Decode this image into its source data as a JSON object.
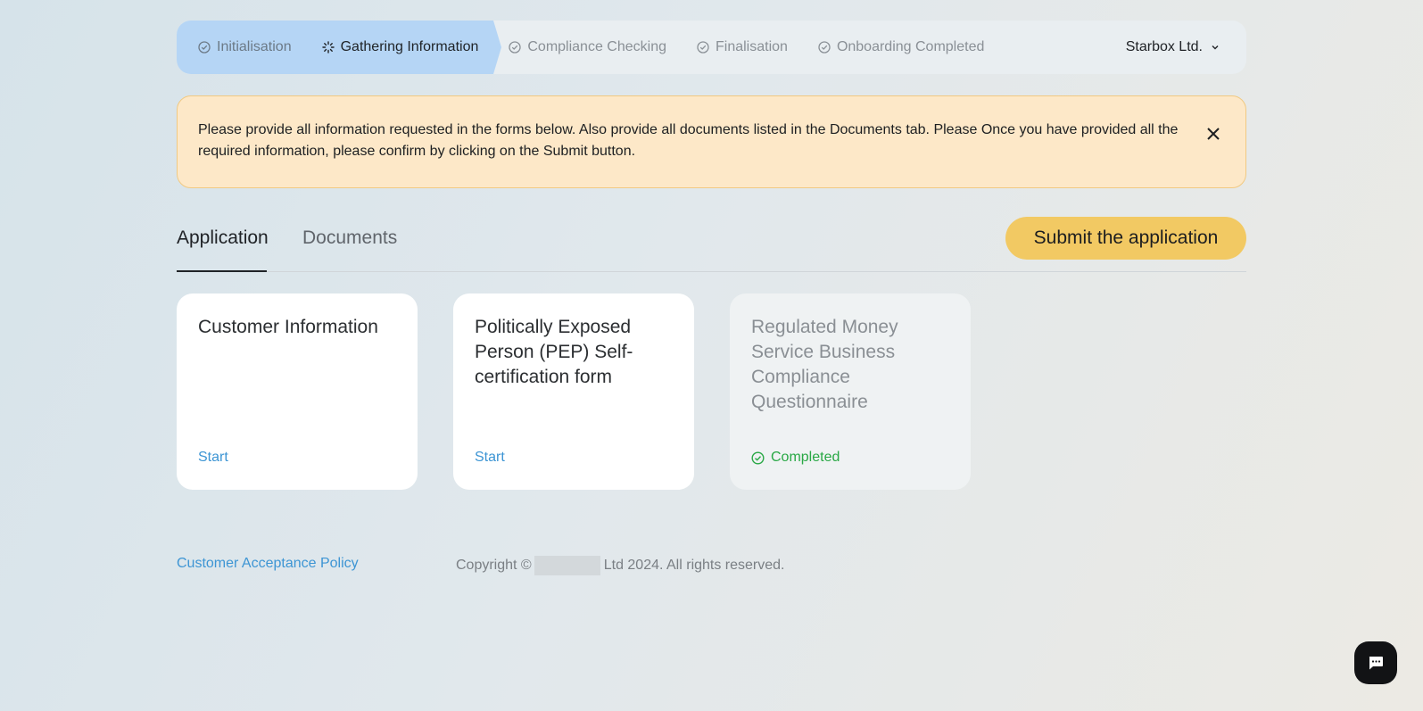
{
  "stepper": {
    "steps": [
      {
        "label": "Initialisation",
        "state": "done"
      },
      {
        "label": "Gathering Information",
        "state": "current"
      },
      {
        "label": "Compliance Checking",
        "state": "pending"
      },
      {
        "label": "Finalisation",
        "state": "pending"
      },
      {
        "label": "Onboarding Completed",
        "state": "pending"
      }
    ],
    "company": "Starbox Ltd."
  },
  "alert": {
    "message": "Please provide all information requested in the forms below. Also provide all documents listed in the Documents tab. Please Once you have provided all the required information, please confirm by clicking on the Submit button."
  },
  "tabs": {
    "items": [
      {
        "label": "Application",
        "active": true
      },
      {
        "label": "Documents",
        "active": false
      }
    ],
    "submit_label": "Submit the application"
  },
  "cards": [
    {
      "title": "Customer Information",
      "action": "Start",
      "status": "not-started"
    },
    {
      "title": "Politically Exposed Person (PEP) Self-certification form",
      "action": "Start",
      "status": "not-started"
    },
    {
      "title": "Regulated Money Service Business Compliance Questionnaire",
      "action": "Completed",
      "status": "completed"
    }
  ],
  "footer": {
    "policy_link": "Customer Acceptance Policy",
    "copyright_prefix": "Copyright ©",
    "copyright_suffix": "Ltd 2024. All rights reserved."
  },
  "colors": {
    "accent_blue": "#3d95d4",
    "submit_yellow": "#f2c963",
    "success_green": "#29a845",
    "alert_bg": "#fde8c8"
  },
  "icons": {
    "step_done": "check-circle-icon",
    "step_current": "spinner-icon",
    "company_dropdown": "chevron-down-icon",
    "alert_close": "close-icon",
    "completed": "check-circle-icon",
    "chat": "chat-bubble-icon"
  }
}
